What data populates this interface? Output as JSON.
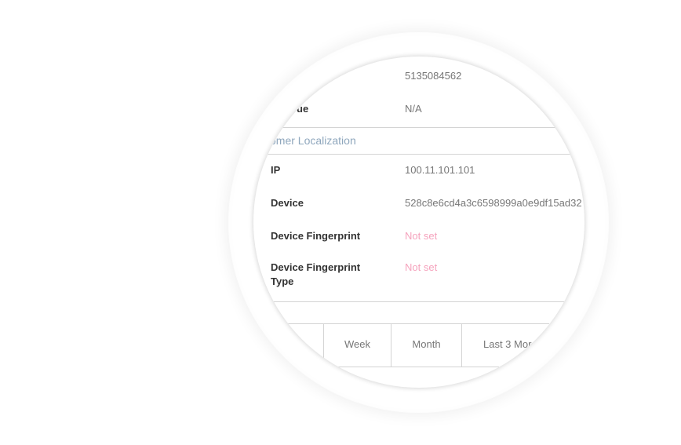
{
  "details": {
    "phone_value": "5135084562",
    "partial_label": "ue",
    "partial_value": "N/A"
  },
  "section": {
    "title_partial": "omer Localization"
  },
  "localization": {
    "ip_label": "IP",
    "ip_value": "100.11.101.101",
    "device_label": "Device",
    "device_value": "528c8e6cd4a3c6598999a0e9df15ad32",
    "fingerprint_label": "Device Fingerprint",
    "fingerprint_value": "Not set",
    "fingerprint_type_label_line1": "Device Fingerprint",
    "fingerprint_type_label_line2": "Type",
    "fingerprint_type_value": "Not set"
  },
  "period_tabs": {
    "week": "Week",
    "month": "Month",
    "last3": "Last 3 Mor"
  },
  "colors": {
    "label": "#333333",
    "value": "#777777",
    "not_set": "#f5a3bd",
    "section_title": "#8fa7bd",
    "divider": "#d4d4d4"
  }
}
